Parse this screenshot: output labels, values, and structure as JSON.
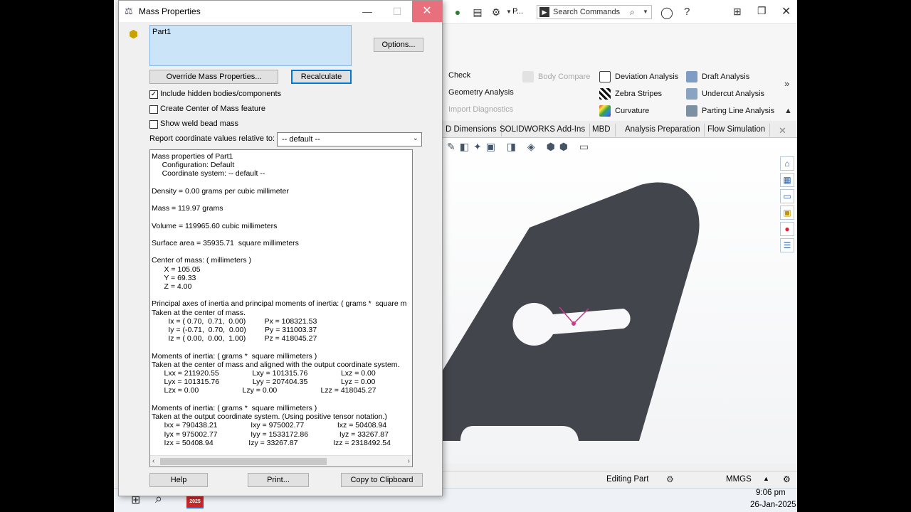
{
  "dialog": {
    "title": "Mass Properties",
    "selection": "Part1",
    "options_button": "Options...",
    "override_button": "Override Mass Properties...",
    "recalculate_button": "Recalculate",
    "checkboxes": [
      {
        "label": "Include hidden bodies/components",
        "checked": true
      },
      {
        "label": "Create Center of Mass feature",
        "checked": false
      },
      {
        "label": "Show weld bead mass",
        "checked": false
      }
    ],
    "coord_label": "Report coordinate values relative to:",
    "coord_value": "-- default --",
    "results_lines": [
      "Mass properties of Part1",
      "     Configuration: Default",
      "     Coordinate system: -- default --",
      "",
      "Density = 0.00 grams per cubic millimeter",
      "",
      "Mass = 119.97 grams",
      "",
      "Volume = 119965.60 cubic millimeters",
      "",
      "Surface area = 35935.71  square millimeters",
      "",
      "Center of mass: ( millimeters )",
      "      X = 105.05",
      "      Y = 69.33",
      "      Z = 4.00",
      "",
      "Principal axes of inertia and principal moments of inertia: ( grams *  square m",
      "Taken at the center of mass.",
      "        Ix = ( 0.70,  0.71,  0.00)         Px = 108321.53",
      "        Iy = (-0.71,  0.70,  0.00)         Py = 311003.37",
      "        Iz = ( 0.00,  0.00,  1.00)         Pz = 418045.27",
      "",
      "Moments of inertia: ( grams *  square millimeters )",
      "Taken at the center of mass and aligned with the output coordinate system.",
      "      Lxx = 211920.55                Lxy = 101315.76                Lxz = 0.00",
      "      Lyx = 101315.76                Lyy = 207404.35                Lyz = 0.00",
      "      Lzx = 0.00                     Lzy = 0.00                     Lzz = 418045.27",
      "",
      "Moments of inertia: ( grams *  square millimeters )",
      "Taken at the output coordinate system. (Using positive tensor notation.)",
      "      Ixx = 790438.21                Ixy = 975002.77                Ixz = 50408.94",
      "      Iyx = 975002.77                Iyy = 1533172.86               Iyz = 33267.87",
      "      Izx = 50408.94                 Izy = 33267.87                 Izz = 2318492.54"
    ],
    "help_button": "Help",
    "print_button": "Print...",
    "copy_button": "Copy to Clipboard"
  },
  "solidworks": {
    "toolbar_p": "P...",
    "search_placeholder": "Search Commands",
    "ribbon": {
      "col1": [
        "Check",
        "Geometry Analysis",
        "Import Diagnostics"
      ],
      "col1_disabled": [
        false,
        false,
        true
      ],
      "body_compare": "Body Compare",
      "col2": [
        "Deviation Analysis",
        "Zebra Stripes",
        "Curvature"
      ],
      "col3": [
        "Draft Analysis",
        "Undercut Analysis",
        "Parting Line Analysis"
      ]
    },
    "tabs": [
      "D Dimensions",
      "SOLIDWORKS Add-Ins",
      "MBD",
      "Analysis Preparation",
      "Flow Simulation"
    ],
    "status": {
      "editing": "Editing Part",
      "units": "MMGS"
    }
  },
  "taskbar": {
    "time": "9:06 pm",
    "date": "26-Jan-2025",
    "app_badge": "2025"
  },
  "colors": {
    "part_fill": "#43454c",
    "close_hover": "#e8707c",
    "selection_bg": "#cce4f7",
    "default_button_border": "#0078d7"
  }
}
